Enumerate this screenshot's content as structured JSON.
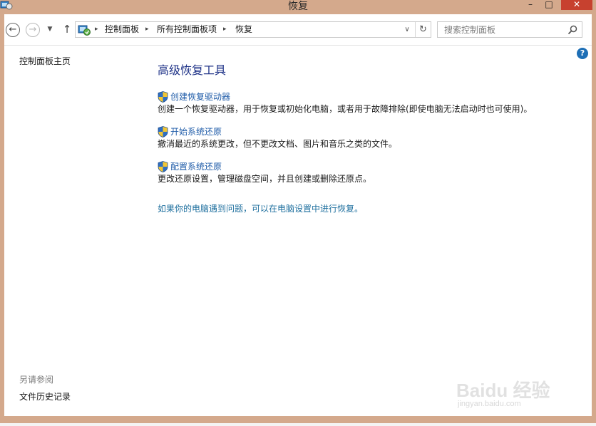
{
  "window": {
    "title": "恢复",
    "minimize_label": "–",
    "maximize_label": "□",
    "close_label": "✕"
  },
  "nav": {
    "back_glyph": "←",
    "forward_glyph": "→",
    "recent_glyph": "▼",
    "up_glyph": "↑",
    "breadcrumbs": [
      "控制面板",
      "所有控制面板项",
      "恢复"
    ],
    "separator": "▸",
    "dropdown_glyph": "∨",
    "refresh_glyph": "↻",
    "search_placeholder": "搜索控制面板"
  },
  "sidebar": {
    "home_link": "控制面板主页",
    "see_also_header": "另请参阅",
    "see_also_items": [
      "文件历史记录"
    ]
  },
  "main": {
    "heading": "高级恢复工具",
    "tasks": [
      {
        "link": "创建恢复驱动器",
        "description": "创建一个恢复驱动器，用于恢复或初始化电脑，或者用于故障排除(即使电脑无法启动时也可使用)。",
        "icon": "uac-shield-icon"
      },
      {
        "link": "开始系统还原",
        "description": "撤消最近的系统更改，但不更改文档、图片和音乐之类的文件。",
        "icon": "uac-shield-icon"
      },
      {
        "link": "配置系统还原",
        "description": "更改还原设置，管理磁盘空间，并且创建或删除还原点。",
        "icon": "uac-shield-icon"
      }
    ],
    "pc_settings_link": "如果你的电脑遇到问题，可以在电脑设置中进行恢复。"
  },
  "help_glyph": "?",
  "watermark": {
    "main": "Baidu 经验",
    "sub": "jingyan.baidu.com"
  },
  "colors": {
    "frame": "#d4a98c",
    "heading": "#1e3287",
    "link": "#1e5ba8",
    "close_button": "#c7412f"
  }
}
